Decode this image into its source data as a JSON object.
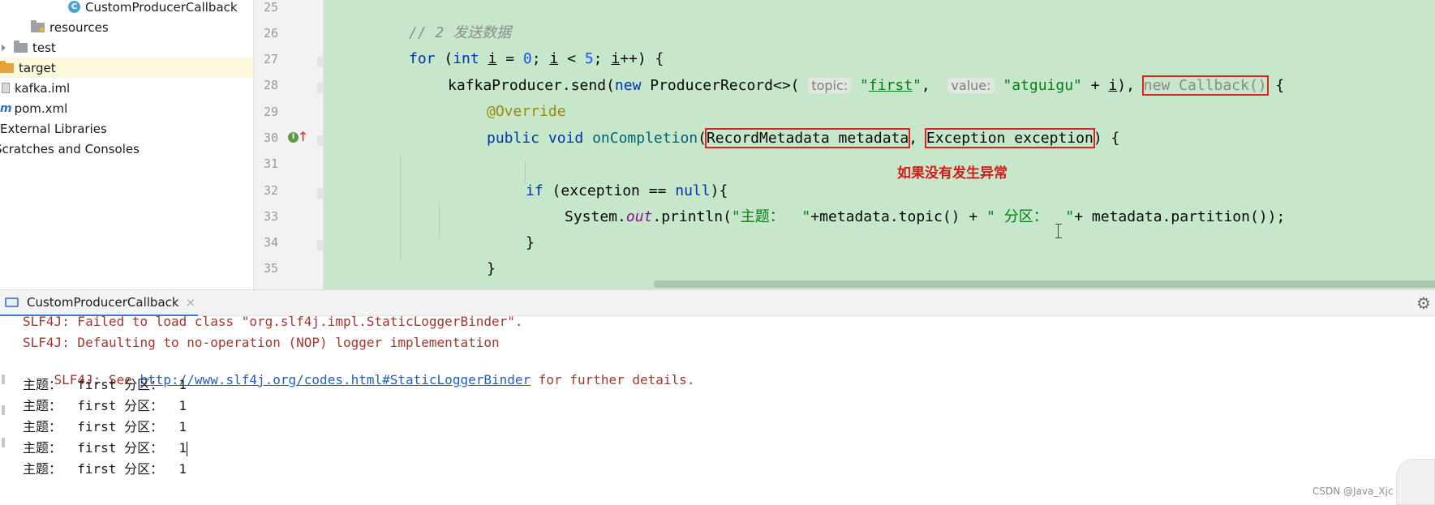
{
  "project_tree": {
    "items": [
      {
        "label": "CustomProducerCallback",
        "icon": "java-class-icon"
      },
      {
        "label": "resources",
        "icon": "resources-folder-icon"
      },
      {
        "label": "test",
        "icon": "folder-icon"
      },
      {
        "label": "target",
        "icon": "folder-icon"
      },
      {
        "label": "kafka.iml",
        "icon": "iml-file-icon"
      },
      {
        "label": "pom.xml",
        "icon": "maven-file-icon"
      },
      {
        "label": "External Libraries",
        "icon": "libraries-icon"
      },
      {
        "label": "Scratches and Consoles",
        "icon": "scratches-icon"
      }
    ],
    "class_icon_letter": "C",
    "maven_icon_letter": "m"
  },
  "editor": {
    "line_numbers": [
      "25",
      "26",
      "27",
      "28",
      "29",
      "30",
      "31",
      "32",
      "33",
      "34",
      "35"
    ],
    "lines": [
      {
        "number": "25",
        "segments": []
      },
      {
        "number": "26",
        "segments": [
          {
            "t": "// 2 发送数据",
            "c": "com"
          }
        ]
      },
      {
        "number": "27",
        "segments": [
          {
            "t": "for",
            "c": "kw"
          },
          {
            "t": " (",
            "c": ""
          },
          {
            "t": "int",
            "c": "kw"
          },
          {
            "t": " ",
            "c": ""
          },
          {
            "t": "i",
            "c": "ul"
          },
          {
            "t": " = ",
            "c": ""
          },
          {
            "t": "0",
            "c": "num"
          },
          {
            "t": "; ",
            "c": ""
          },
          {
            "t": "i",
            "c": "ul"
          },
          {
            "t": " < ",
            "c": ""
          },
          {
            "t": "5",
            "c": "num"
          },
          {
            "t": "; ",
            "c": ""
          },
          {
            "t": "i",
            "c": "ul"
          },
          {
            "t": "++) {",
            "c": ""
          }
        ]
      },
      {
        "number": "28",
        "segments": [
          {
            "t": "kafkaProducer.send(",
            "c": ""
          },
          {
            "t": "new",
            "c": "kw"
          },
          {
            "t": " ProducerRecord<>( ",
            "c": ""
          },
          {
            "t": "topic:",
            "c": "hint"
          },
          {
            "t": " ",
            "c": ""
          },
          {
            "t": "\"",
            "c": "str"
          },
          {
            "t": "first",
            "c": "str ul"
          },
          {
            "t": "\"",
            "c": "str"
          },
          {
            "t": ",  ",
            "c": ""
          },
          {
            "t": "value:",
            "c": "hint"
          },
          {
            "t": " ",
            "c": ""
          },
          {
            "t": "\"atguigu\"",
            "c": "str"
          },
          {
            "t": " + ",
            "c": ""
          },
          {
            "t": "i",
            "c": "ul"
          },
          {
            "t": "), ",
            "c": ""
          },
          {
            "t": "new Callback()",
            "c": "dim hl"
          },
          {
            "t": " {",
            "c": ""
          }
        ]
      },
      {
        "number": "29",
        "segments": [
          {
            "t": "@Override",
            "c": "ann"
          }
        ]
      },
      {
        "number": "30",
        "segments": [
          {
            "t": "public",
            "c": "kw"
          },
          {
            "t": " ",
            "c": ""
          },
          {
            "t": "void",
            "c": "kw"
          },
          {
            "t": " ",
            "c": ""
          },
          {
            "t": "onCompletion",
            "c": "fn"
          },
          {
            "t": "(",
            "c": ""
          },
          {
            "t": "RecordMetadata metadata",
            "c": "hl"
          },
          {
            "t": ", ",
            "c": ""
          },
          {
            "t": "Exception exception",
            "c": "hl"
          },
          {
            "t": ") {",
            "c": ""
          }
        ]
      },
      {
        "number": "31",
        "segments": []
      },
      {
        "number": "32",
        "segments": [
          {
            "t": "if",
            "c": "kw"
          },
          {
            "t": " (exception == ",
            "c": ""
          },
          {
            "t": "null",
            "c": "kw"
          },
          {
            "t": "){",
            "c": ""
          }
        ]
      },
      {
        "number": "33",
        "segments": [
          {
            "t": "System.",
            "c": ""
          },
          {
            "t": "out",
            "c": "fld"
          },
          {
            "t": ".println(",
            "c": ""
          },
          {
            "t": "\"主题：  \"",
            "c": "str"
          },
          {
            "t": "+metadata.topic() + ",
            "c": ""
          },
          {
            "t": "\" 分区：  \"",
            "c": "str"
          },
          {
            "t": "+ metadata.partition());",
            "c": ""
          }
        ]
      },
      {
        "number": "34",
        "segments": [
          {
            "t": "}",
            "c": ""
          }
        ]
      },
      {
        "number": "35",
        "segments": [
          {
            "t": "}",
            "c": ""
          }
        ]
      }
    ],
    "annotation": "如果没有发生异常"
  },
  "run_panel": {
    "tab_label": "CustomProducerCallback",
    "close_glyph": "×",
    "gear_glyph": "⚙",
    "console": {
      "slf4j_failed": "SLF4J: Failed to load class \"org.slf4j.impl.StaticLoggerBinder\".",
      "slf4j_default": "SLF4J: Defaulting to no-operation (NOP) logger implementation",
      "slf4j_see_prefix": "SLF4J: See ",
      "slf4j_link": "http://www.slf4j.org/codes.html#StaticLoggerBinder",
      "slf4j_see_suffix": " for further details.",
      "output_lines": [
        "主题：  first 分区：  1",
        "主题：  first 分区：  1",
        "主题：  first 分区：  1",
        "主题：  first 分区：  1",
        "主题：  first 分区：  1"
      ]
    }
  },
  "watermark": "CSDN @Java_Xjc",
  "colors": {
    "editor_bg": "#c6e7c9",
    "keyword": "#0033b3",
    "string": "#067d17",
    "highlight_box": "#dd2222",
    "annotation_text": "#d41a1a",
    "log_red": "#a3362e",
    "link": "#1f5fbf",
    "tab_underline": "#3e7bd4"
  }
}
